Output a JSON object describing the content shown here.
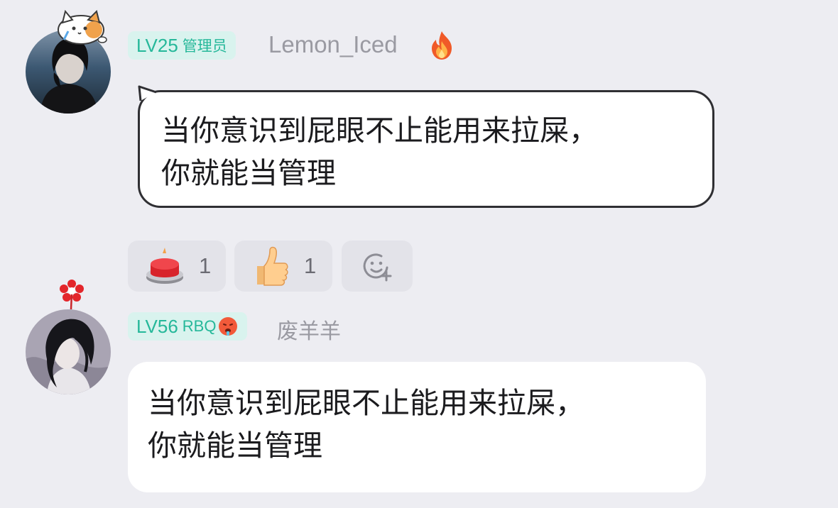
{
  "messages": [
    {
      "level": "LV25",
      "role": "管理员",
      "username": "Lemon_Iced",
      "username_badge_icon": "fire-icon",
      "avatar_icon": "avatar-dark-hair-person",
      "avatar_accessory_icon": "cat-sticker-icon",
      "text": "当你意识到屁眼不止能用来拉屎，\n你就能当管理",
      "bubble_style": "outlined",
      "reactions": [
        {
          "icon": "red-button-emoji-icon",
          "count": "1"
        },
        {
          "icon": "thumbs-up-emoji-icon",
          "count": "1"
        }
      ],
      "add_reaction_icon": "add-emoji-icon"
    },
    {
      "level": "LV56",
      "role": "RBQ",
      "role_icon": "flushed-hot-face-icon",
      "username": "废羊羊",
      "avatar_icon": "avatar-anime-dark-hair",
      "avatar_accessory_icon": "red-flower-icon",
      "text": "当你意识到屁眼不止能用来拉屎，\n你就能当管理",
      "bubble_style": "plain"
    }
  ],
  "colors": {
    "background": "#ededf2",
    "badge_bg": "#d9f3ee",
    "badge_text": "#26b89a",
    "username": "#9a9aa2",
    "bubble": "#ffffff",
    "reaction_bg": "#e3e3e9"
  }
}
